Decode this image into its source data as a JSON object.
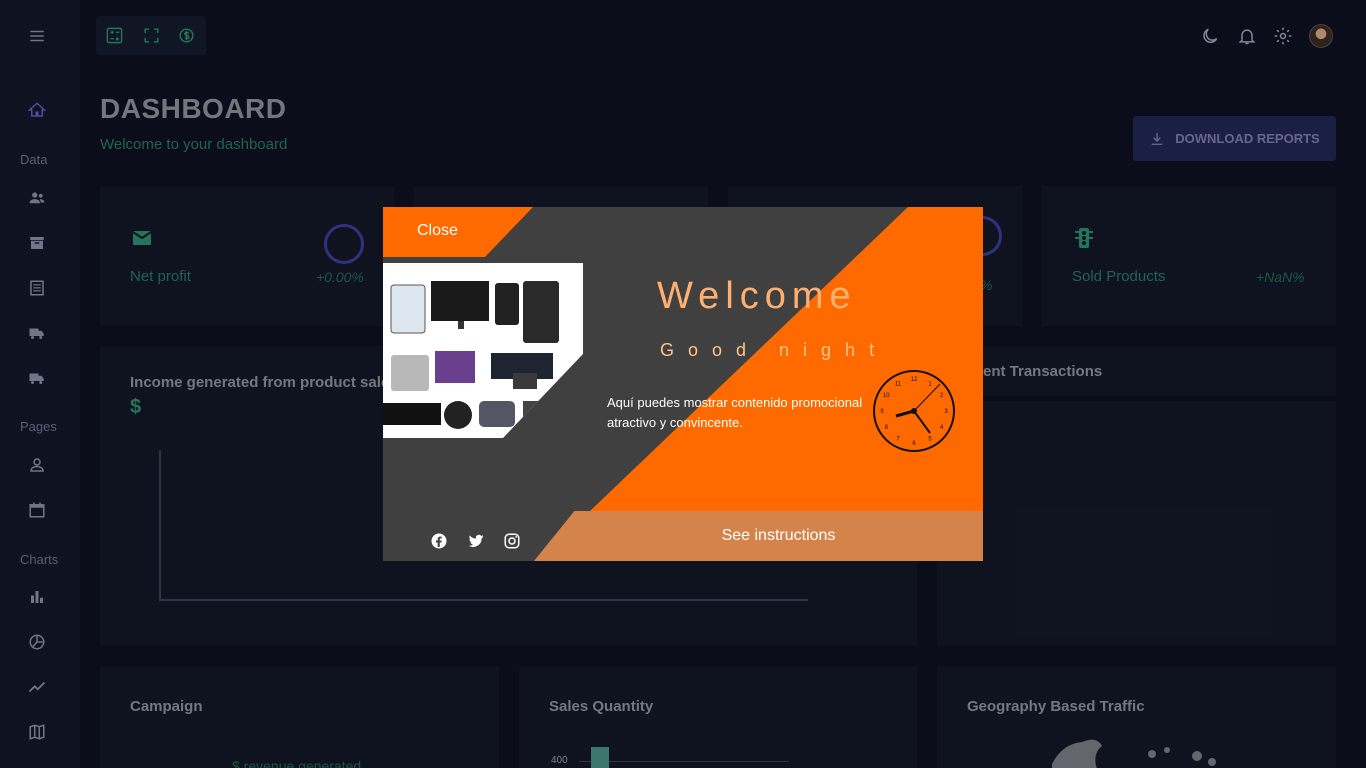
{
  "sidebar": {
    "sections": [
      "Data",
      "Pages",
      "Charts"
    ],
    "icons": [
      "menu-icon",
      "home-icon",
      "team-icon",
      "contacts-icon",
      "invoices-icon",
      "truck-icon",
      "delivery-icon",
      "profile-icon",
      "calendar-icon",
      "bar-chart-icon",
      "pie-chart-icon",
      "line-chart-icon",
      "map-icon"
    ]
  },
  "topbar": {
    "left_icons": [
      "calculator-icon",
      "fullscreen-icon",
      "currency-exchange-icon"
    ],
    "right_icons": [
      "moon-icon",
      "bell-icon",
      "gear-icon",
      "avatar"
    ]
  },
  "header": {
    "title": "DASHBOARD",
    "subtitle": "Welcome to your dashboard",
    "download_label": "DOWNLOAD REPORTS"
  },
  "stats": [
    {
      "label": "Net profit",
      "pct": "+0.00%"
    },
    {
      "label": "",
      "pct": ""
    },
    {
      "label": "",
      "pct": "%"
    },
    {
      "label": "Sold Products",
      "pct": "+NaN%"
    }
  ],
  "panels": {
    "income_title": "Income generated from product sales",
    "income_symbol": "$",
    "transactions_title": "ent Transactions",
    "campaign_title": "Campaign",
    "campaign_sub": "$ revenue generated",
    "sales_title": "Sales Quantity",
    "sales_tick": "400",
    "geo_title": "Geography Based Traffic"
  },
  "modal": {
    "close_label": "Close",
    "welcome": "Welcome",
    "greeting": "Good night",
    "promo_text": "Aquí puedes mostrar contenido promocional atractivo y convincente.",
    "instructions_label": "See instructions",
    "social": [
      "facebook-icon",
      "twitter-icon",
      "instagram-icon"
    ],
    "clock_numbers": [
      "12",
      "1",
      "2",
      "3",
      "4",
      "5",
      "6",
      "7",
      "8",
      "9",
      "10",
      "11"
    ]
  },
  "colors": {
    "accent_orange": "#ff6a00",
    "accent_green": "#2e8f73",
    "accent_indigo": "#3a3e9a",
    "background": "#0e1120"
  }
}
